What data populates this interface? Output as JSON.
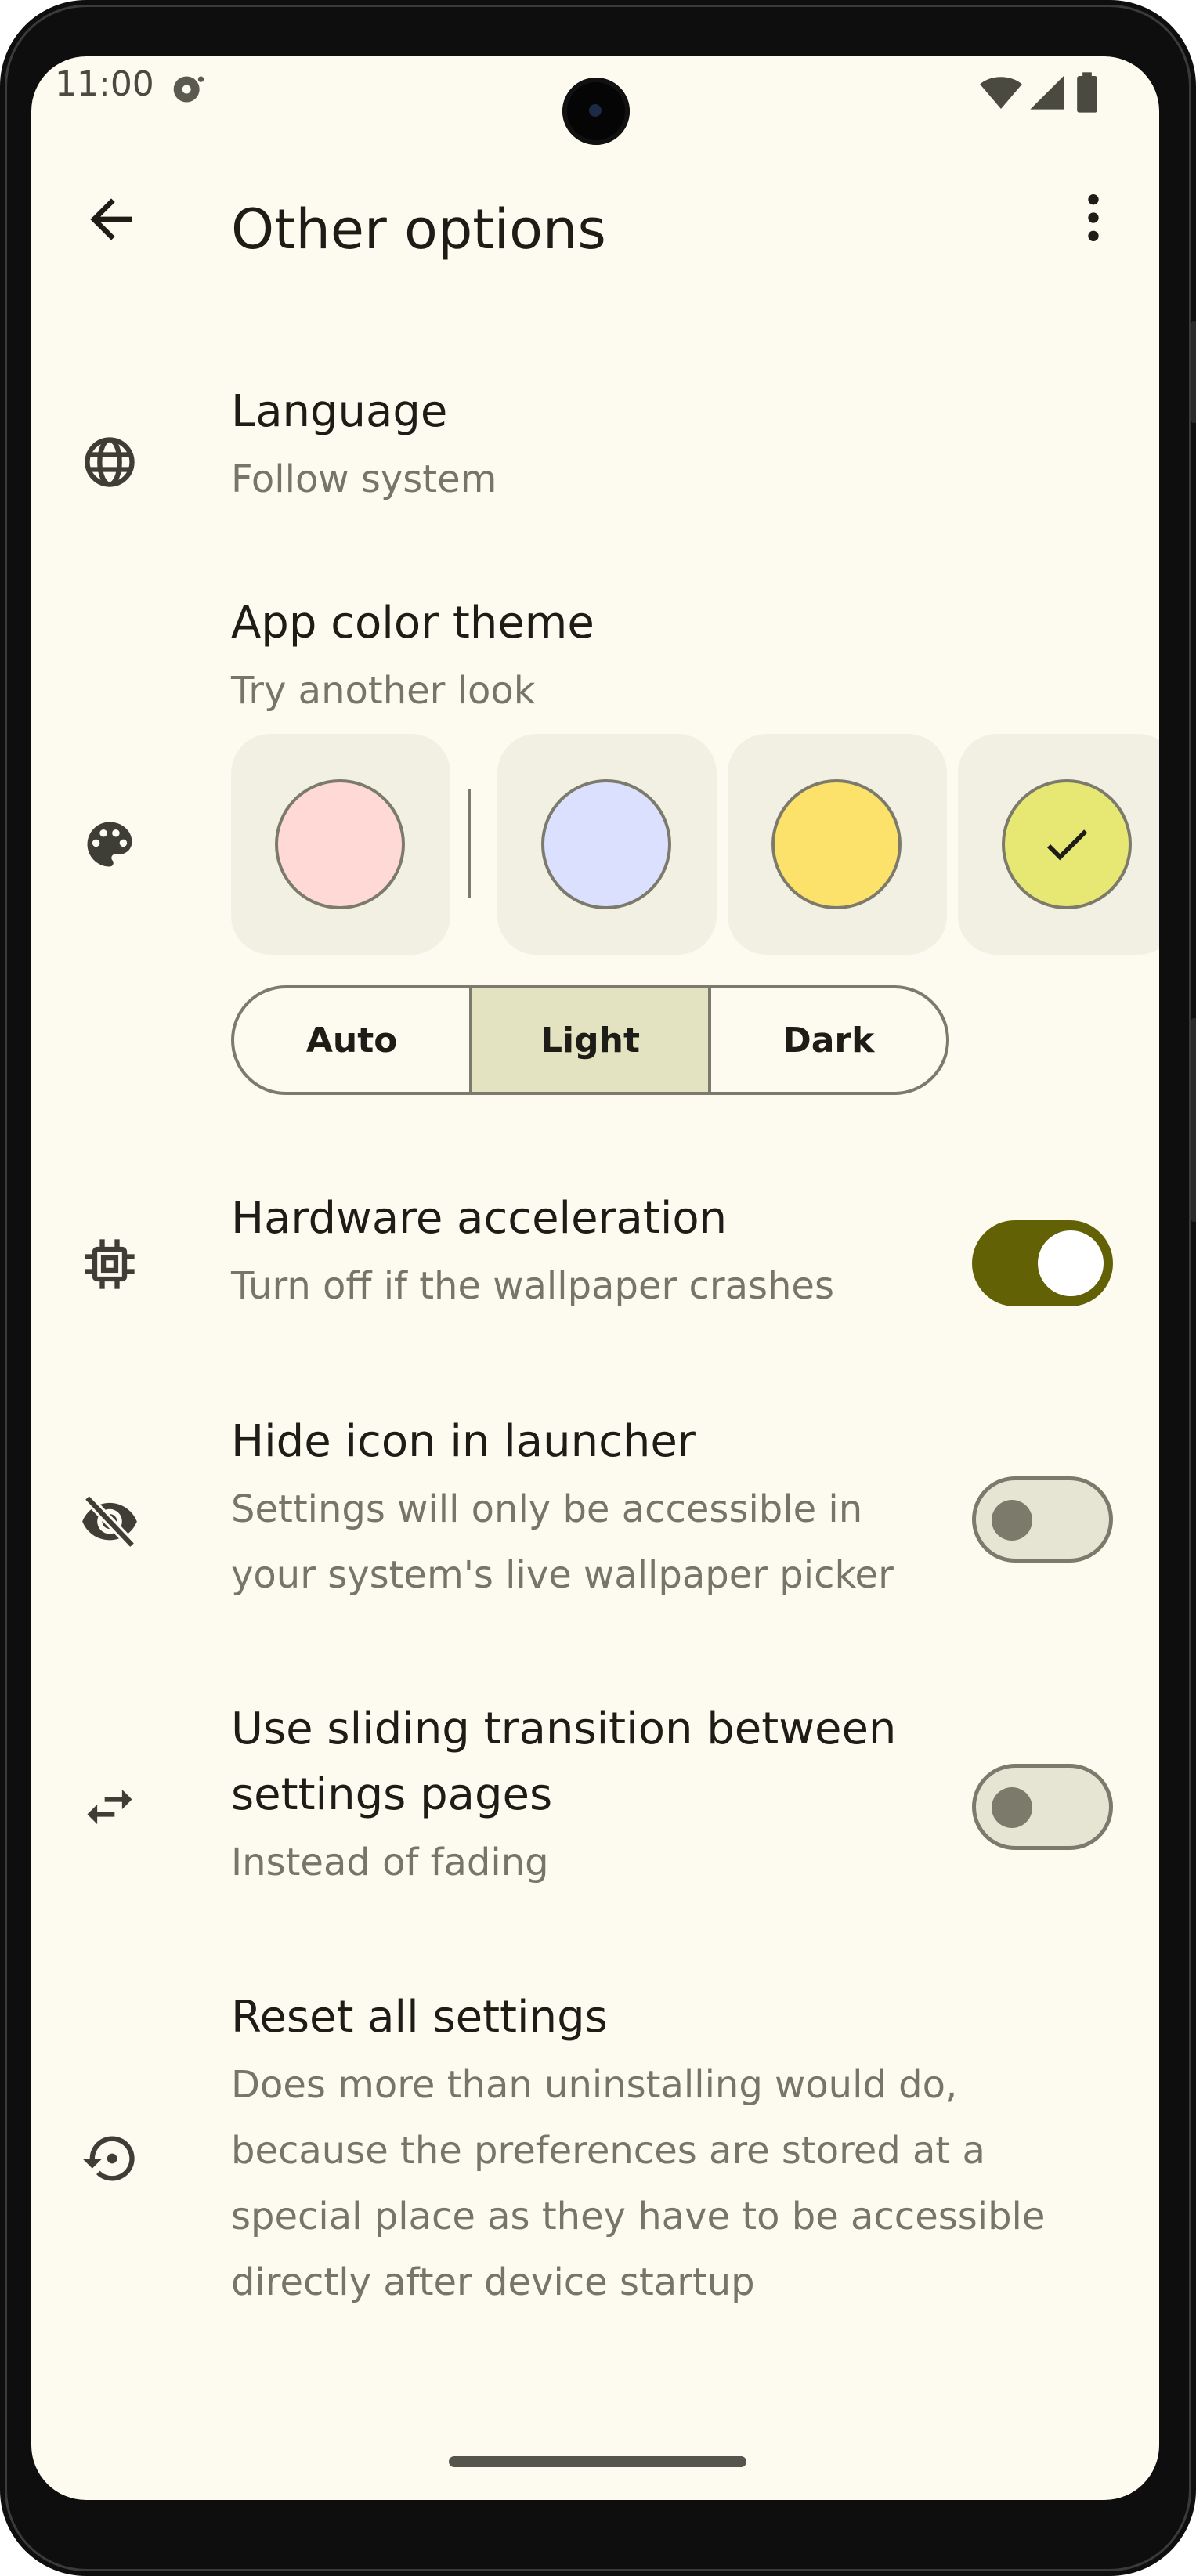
{
  "status_bar": {
    "time": "11:00",
    "icons": [
      "sync-icon",
      "wifi-icon",
      "signal-icon",
      "battery-icon"
    ]
  },
  "app_bar": {
    "title": "Other options",
    "back_icon": "arrow-back-icon",
    "menu_icon": "more-vert-icon"
  },
  "settings": {
    "language": {
      "title": "Language",
      "subtitle": "Follow system",
      "icon": "globe-icon"
    },
    "theme": {
      "title": "App color theme",
      "subtitle": "Try another look",
      "icon": "palette-icon",
      "swatches": [
        {
          "color": "#ffd9d6",
          "selected": false
        },
        {
          "color": "#dbe0ff",
          "selected": false
        },
        {
          "color": "#fce26a",
          "selected": false
        },
        {
          "color": "#e6e873",
          "selected": true
        }
      ],
      "modes": [
        "Auto",
        "Light",
        "Dark"
      ],
      "selected_mode": "Light"
    },
    "hardware_acceleration": {
      "title": "Hardware acceleration",
      "subtitle": "Turn off if the wallpaper crashes",
      "icon": "chip-icon",
      "enabled": true
    },
    "hide_icon": {
      "title": "Hide icon in launcher",
      "subtitle_line1": "Settings will only be accessible in",
      "subtitle_line2": "your system's live wallpaper picker",
      "icon": "visibility-off-icon",
      "enabled": false
    },
    "sliding_transition": {
      "title_line1": "Use sliding transition between",
      "title_line2": "settings pages",
      "subtitle": "Instead of fading",
      "icon": "swap-arrows-icon",
      "enabled": false
    },
    "reset": {
      "title": "Reset all settings",
      "subtitle_line1": "Does more than uninstalling would do,",
      "subtitle_line2": "because the preferences are stored at a",
      "subtitle_line3": "special place as they have to be accessible",
      "subtitle_line4": "directly after device startup",
      "icon": "restore-icon"
    }
  },
  "colors": {
    "background": "#fdfbf0",
    "switch_on": "#626106",
    "switch_off": "#e6e4d2",
    "segment_selected": "#e4e3c1",
    "text_primary": "#1d1c16",
    "text_secondary": "#76756a"
  }
}
